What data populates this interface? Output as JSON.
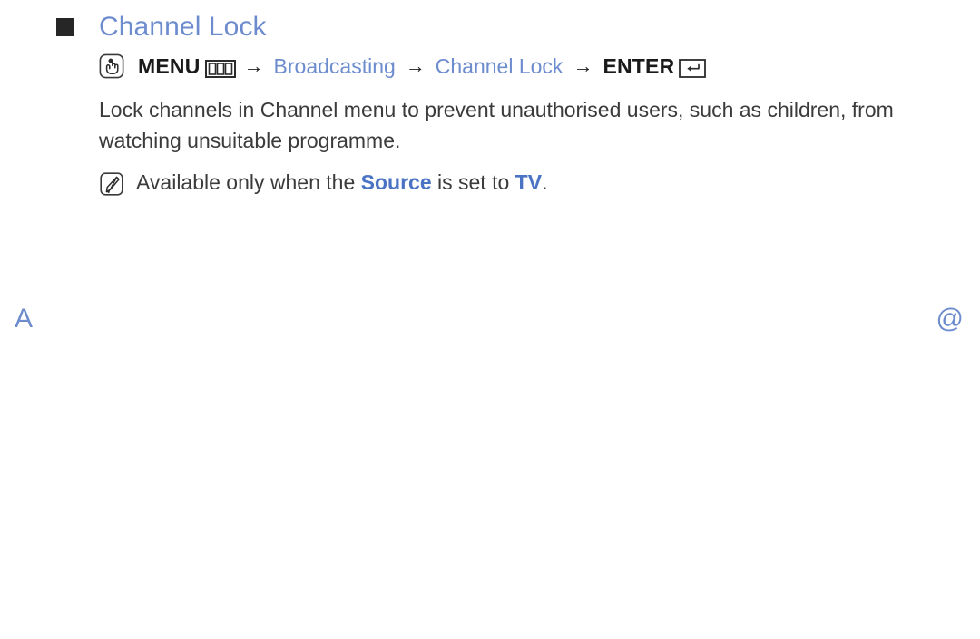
{
  "page": {
    "background": "#ffffff",
    "accent_blue": "#6d8cce",
    "strong_blue": "#4a73c4",
    "text_color": "#3b3b3b",
    "bullet_color": "#262626"
  },
  "heading": {
    "bullet": "square-bullet",
    "title": "Channel Lock"
  },
  "menu_path": {
    "menu_icon": "menu-hand-icon",
    "menu_label": "MENU",
    "panes_icon": "menu-panes-icon",
    "arrow1": "→",
    "step1": "Broadcasting",
    "arrow2": "→",
    "step2": "Channel Lock",
    "arrow3": "→",
    "enter_label": "ENTER",
    "return_icon": "enter-return-icon"
  },
  "body": {
    "paragraph": "Lock channels in Channel menu to prevent unauthorised users, such as children, from watching unsuitable programme."
  },
  "note": {
    "icon": "note-pencil-icon",
    "prefix": "Available only when the ",
    "highlight1": "Source",
    "middle": " is set to ",
    "highlight2": "TV",
    "suffix": "."
  },
  "corner_marks": {
    "left": "A",
    "right": "@"
  }
}
